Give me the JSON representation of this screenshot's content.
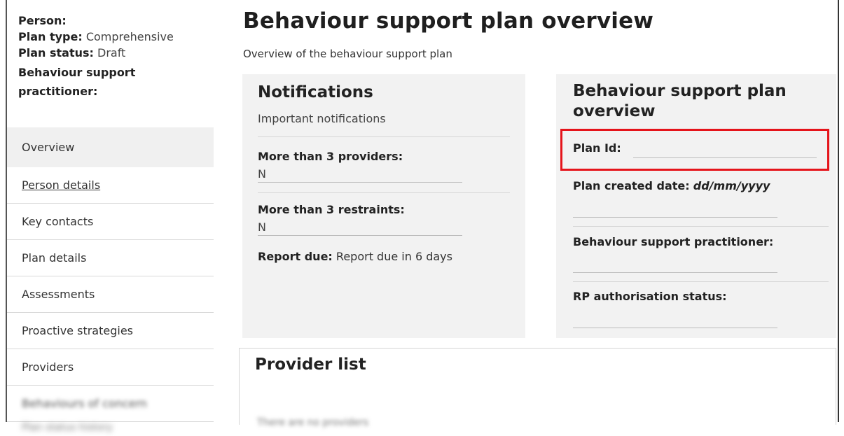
{
  "sidebar": {
    "person_label": "Person:",
    "plan_type_label": "Plan type:",
    "plan_type_value": "Comprehensive",
    "plan_status_label": "Plan status:",
    "plan_status_value": "Draft",
    "practitioner_label_line1": "Behaviour support",
    "practitioner_label_line2": "practitioner:",
    "nav": [
      {
        "label": "Overview",
        "state": "active"
      },
      {
        "label": "Person details",
        "state": "link"
      },
      {
        "label": "Key contacts",
        "state": "normal"
      },
      {
        "label": "Plan details",
        "state": "normal"
      },
      {
        "label": "Assessments",
        "state": "normal"
      },
      {
        "label": "Proactive strategies",
        "state": "normal"
      },
      {
        "label": "Providers",
        "state": "normal"
      },
      {
        "label": "Behaviours of concern",
        "state": "blurred"
      },
      {
        "label": "Plan status history",
        "state": "blurred"
      }
    ]
  },
  "main": {
    "title": "Behaviour support plan overview",
    "subtitle": "Overview of the behaviour support plan"
  },
  "notifications": {
    "title": "Notifications",
    "subtitle": "Important notifications",
    "providers_label": "More than 3 providers:",
    "providers_value": "N",
    "restraints_label": "More than 3 restraints:",
    "restraints_value": "N",
    "report_label": "Report due:",
    "report_value": "Report due in 6 days"
  },
  "overview": {
    "title_line1": "Behaviour support plan",
    "title_line2": "overview",
    "plan_id_label": "Plan Id:",
    "plan_id_value": "",
    "created_label": "Plan created date:",
    "created_value": "dd/mm/yyyy",
    "practitioner_label": "Behaviour support practitioner:",
    "rp_label": "RP authorisation status:"
  },
  "providers": {
    "title": "Provider list",
    "empty_text": "There are no providers"
  },
  "colors": {
    "highlight": "#e5141b",
    "card_bg": "#f2f2f2",
    "active_nav_bg": "#f0f0f0"
  }
}
